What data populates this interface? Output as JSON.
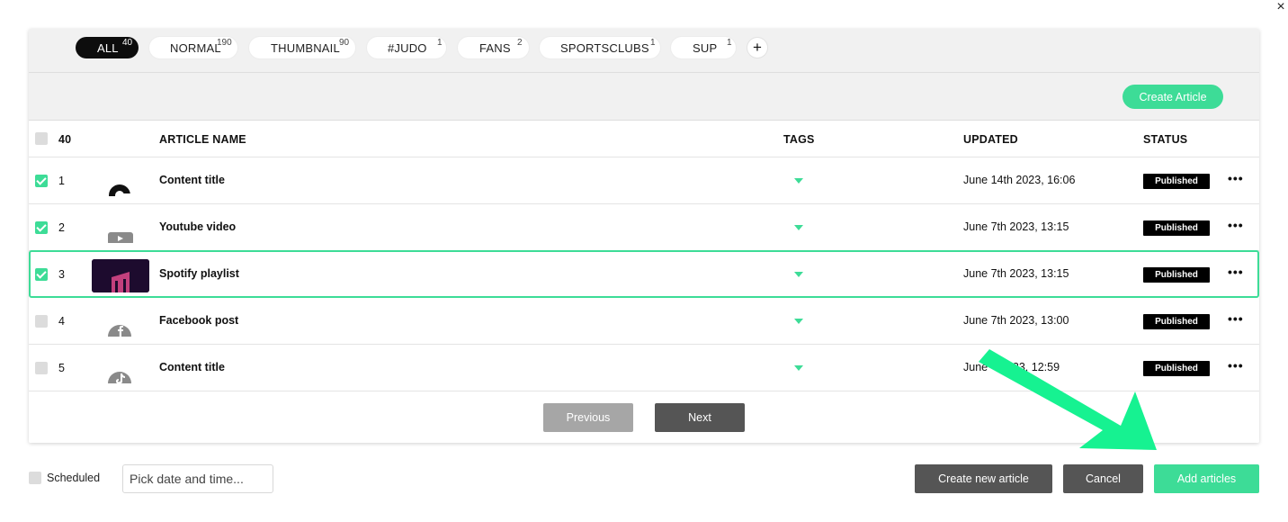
{
  "tags": [
    {
      "label": "ALL",
      "count": "40",
      "active": true
    },
    {
      "label": "NORMAL",
      "count": "190"
    },
    {
      "label": "THUMBNAIL",
      "count": "90"
    },
    {
      "label": "#JUDO",
      "count": "1"
    },
    {
      "label": "FANS",
      "count": "2"
    },
    {
      "label": "SPORTSCLUBS",
      "count": "1"
    },
    {
      "label": "SUP",
      "count": "1"
    }
  ],
  "add_tag_label": "+",
  "toolbar": {
    "create_article_label": "Create Article"
  },
  "table": {
    "count_header": "40",
    "headers": {
      "name": "ARTICLE NAME",
      "tags": "TAGS",
      "updated": "UPDATED",
      "status": "STATUS"
    },
    "rows": [
      {
        "num": "1",
        "name": "Content title",
        "updated": "June 14th 2023, 16:06",
        "status": "Published",
        "checked": true,
        "icon": "gauge-icon"
      },
      {
        "num": "2",
        "name": "Youtube video",
        "updated": "June 7th 2023, 13:15",
        "status": "Published",
        "checked": true,
        "icon": "youtube-icon"
      },
      {
        "num": "3",
        "name": "Spotify playlist",
        "updated": "June 7th 2023, 13:15",
        "status": "Published",
        "checked": true,
        "icon": "playlist-thumbnail"
      },
      {
        "num": "4",
        "name": "Facebook post",
        "updated": "June 7th 2023, 13:00",
        "status": "Published",
        "checked": false,
        "icon": "facebook-icon"
      },
      {
        "num": "5",
        "name": "Content title",
        "updated": "June    2023, 12:59",
        "status": "Published",
        "checked": false,
        "icon": "tiktok-icon"
      }
    ],
    "more_label": "•••"
  },
  "pager": {
    "previous": "Previous",
    "next": "Next"
  },
  "footer": {
    "scheduled_label": "Scheduled",
    "date_placeholder": "Pick date and time...",
    "create_new_label": "Create new article",
    "cancel_label": "Cancel",
    "add_label": "Add articles"
  },
  "close_label": "×",
  "colors": {
    "accent": "#3ddc97",
    "dark_button": "#555555",
    "disabled_button": "#a6a6a6",
    "badge": "#000000"
  }
}
